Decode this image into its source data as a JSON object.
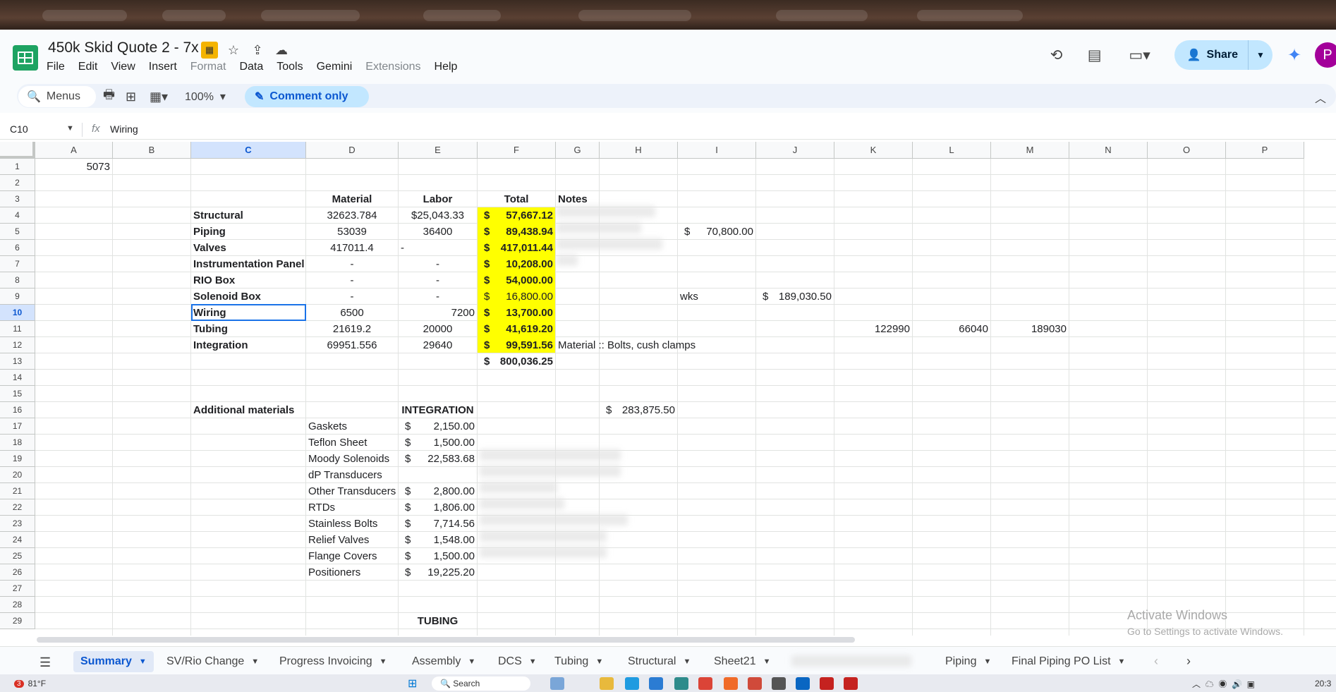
{
  "doc": {
    "title": "450k Skid Quote 2 - 7x"
  },
  "menu": [
    "File",
    "Edit",
    "View",
    "Insert",
    "Format",
    "Data",
    "Tools",
    "Gemini",
    "Extensions",
    "Help"
  ],
  "menu_disabled": [
    "Format",
    "Extensions"
  ],
  "header": {
    "share_label": "Share",
    "avatar_initial": "P"
  },
  "toolbar": {
    "menus_label": "Menus",
    "zoom": "100%",
    "mode_label": "Comment only"
  },
  "formula_bar": {
    "cell_ref": "C10",
    "fx": "fx",
    "value": "Wiring"
  },
  "columns": [
    "A",
    "B",
    "C",
    "D",
    "E",
    "F",
    "G",
    "H",
    "I",
    "J",
    "K",
    "L",
    "M",
    "N",
    "O",
    "P"
  ],
  "selected_column": "C",
  "selected_row": 10,
  "rows": [
    1,
    2,
    3,
    4,
    5,
    6,
    7,
    8,
    9,
    10,
    11,
    12,
    13,
    14,
    15,
    16,
    17,
    18,
    19,
    20,
    21,
    22,
    23,
    24,
    25,
    26,
    27,
    28,
    29
  ],
  "cells": {
    "A1": "5073",
    "D3": "Material",
    "E3": "Labor",
    "F3": "Total",
    "G3": "Notes",
    "C4": "Structural",
    "D4": "32623.784",
    "E4": "$25,043.33",
    "F4": "57,667.12",
    "C5": "Piping",
    "D5": "53039",
    "E5": "36400",
    "F5": "89,438.94",
    "I5": "70,800.00",
    "C6": "Valves",
    "D6": "417011.4",
    "E6": "-",
    "F6": "417,011.44",
    "C7": "Instrumentation Panel",
    "D7": "-",
    "E7": "-",
    "F7": "10,208.00",
    "C8": "RIO Box",
    "D8": "-",
    "E8": "-",
    "F8": "54,000.00",
    "C9": "Solenoid Box",
    "D9": "-",
    "E9": "-",
    "F9": "16,800.00",
    "I9": "wks",
    "J9": "189,030.50",
    "C10": "Wiring",
    "D10": "6500",
    "E10": "7200",
    "F10": "13,700.00",
    "C11": "Tubing",
    "D11": "21619.2",
    "E11": "20000",
    "F11": "41,619.20",
    "K11": "122990",
    "L11": "66040",
    "M11": "189030",
    "C12": "Integration",
    "D12": "69951.556",
    "E12": "29640",
    "F12": "99,591.56",
    "G12": "Material :: Bolts, cush clamps",
    "F13": "800,036.25",
    "C16": "Additional materials",
    "E16": "INTEGRATION",
    "H16": "283,875.50",
    "D17": "Gaskets",
    "E17": "2,150.00",
    "D18": "Teflon Sheet",
    "E18": "1,500.00",
    "D19": "Moody Solenoids",
    "E19": "22,583.68",
    "D20": "dP Transducers",
    "D21": "Other Transducers",
    "E21": "2,800.00",
    "D22": "RTDs",
    "E22": "1,806.00",
    "D23": "Stainless Bolts",
    "E23": "7,714.56",
    "D24": "Relief Valves",
    "E24": "1,548.00",
    "D25": "Flange Covers",
    "E25": "1,500.00",
    "D26": "Positioners",
    "E26": "19,225.20",
    "E29": "TUBING"
  },
  "currency_symbol": "$",
  "colors": {
    "highlight": "#ffff00",
    "selection": "#1a73e8",
    "accent": "#0b57d0"
  },
  "watermark": {
    "title": "Activate Windows",
    "sub": "Go to Settings to activate Windows."
  },
  "sheets": [
    "Summary",
    "SV/Rio Change",
    "Progress Invoicing",
    "Assembly",
    "DCS",
    "Tubing",
    "Structural",
    "Sheet21",
    "Piping",
    "Final Piping PO List"
  ],
  "active_sheet": "Summary",
  "taskbar": {
    "weather_temp": "81°F",
    "notif_count": "3",
    "search_label": "Search",
    "clock": "20:3"
  }
}
